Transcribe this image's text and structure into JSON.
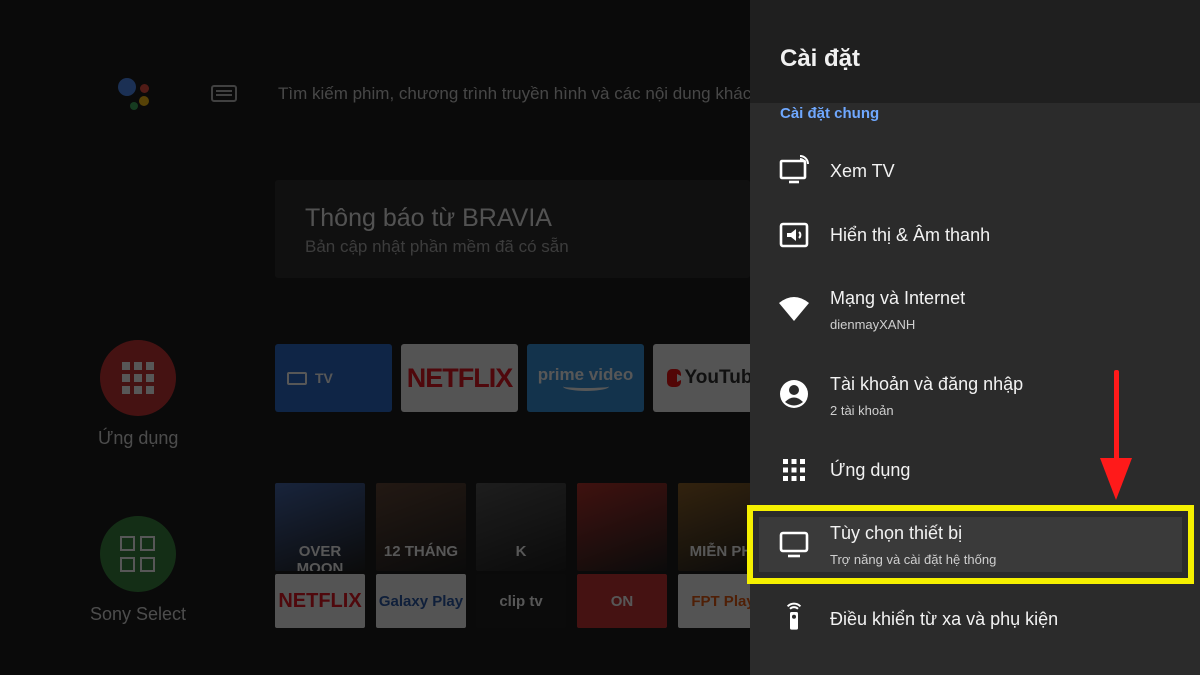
{
  "home": {
    "search_placeholder": "Tìm kiếm phim, chương trình truyền hình và các nội dung khác",
    "notice_title": "Thông báo từ BRAVIA",
    "notice_subtitle": "Bản cập nhật phần mềm đã có sẵn",
    "side_apps": [
      {
        "label": "Ứng dụng",
        "icon": "apps-grid-icon",
        "color": "#c62828"
      },
      {
        "label": "Sony Select",
        "icon": "sony-select-icon",
        "color": "#2e7d32"
      }
    ],
    "app_tiles": [
      {
        "label": "TV",
        "icon": "tv-icon"
      },
      {
        "label": "NETFLIX"
      },
      {
        "label": "prime video"
      },
      {
        "label": "YouTube",
        "icon": "youtube-play-icon"
      }
    ],
    "posters": [
      {
        "label": "OVER MOON",
        "color": "#3b5fa8"
      },
      {
        "label": "12 THÁNG",
        "color": "#5a3b2a"
      },
      {
        "label": "K",
        "color": "#4a4a4a"
      },
      {
        "label": "",
        "color": "#b3261e"
      },
      {
        "label": "MIỄN PHÍ",
        "color": "#8a5a1a"
      }
    ],
    "mini_tiles": [
      {
        "label": "NETFLIX",
        "color": "#f5f5f5",
        "text_color": "#e50914"
      },
      {
        "label": "Galaxy Play",
        "color": "#f5f5f5",
        "text_color": "#1e4fa3"
      },
      {
        "label": "clip tv",
        "color": "#111111",
        "text_color": "#ffffff"
      },
      {
        "label": "ON",
        "color": "#c62828",
        "text_color": "#ffffff"
      },
      {
        "label": "FPT Play",
        "color": "#f5f5f5",
        "text_color": "#e65100"
      }
    ]
  },
  "settings": {
    "title": "Cài đặt",
    "section": "Cài đặt chung",
    "items": [
      {
        "label": "Xem TV",
        "sub": "",
        "icon": "tv-cast-icon"
      },
      {
        "label": "Hiển thị & Âm thanh",
        "sub": "",
        "icon": "display-sound-icon"
      },
      {
        "label": "Mạng và Internet",
        "sub": "dienmayXANH",
        "icon": "wifi-icon"
      },
      {
        "label": "Tài khoản và đăng nhập",
        "sub": "2 tài khoản",
        "icon": "account-icon"
      },
      {
        "label": "Ứng dụng",
        "sub": "",
        "icon": "apps-grid-icon"
      },
      {
        "label": "Tùy chọn thiết bị",
        "sub": "Trợ năng và cài đặt hệ thống",
        "icon": "device-tv-icon"
      },
      {
        "label": "Điều khiển từ xa và phụ kiện",
        "sub": "",
        "icon": "remote-icon"
      }
    ],
    "highlight_color": "#f5f000",
    "arrow_color": "#ff1a1a",
    "accent": "#6fa8ff"
  }
}
